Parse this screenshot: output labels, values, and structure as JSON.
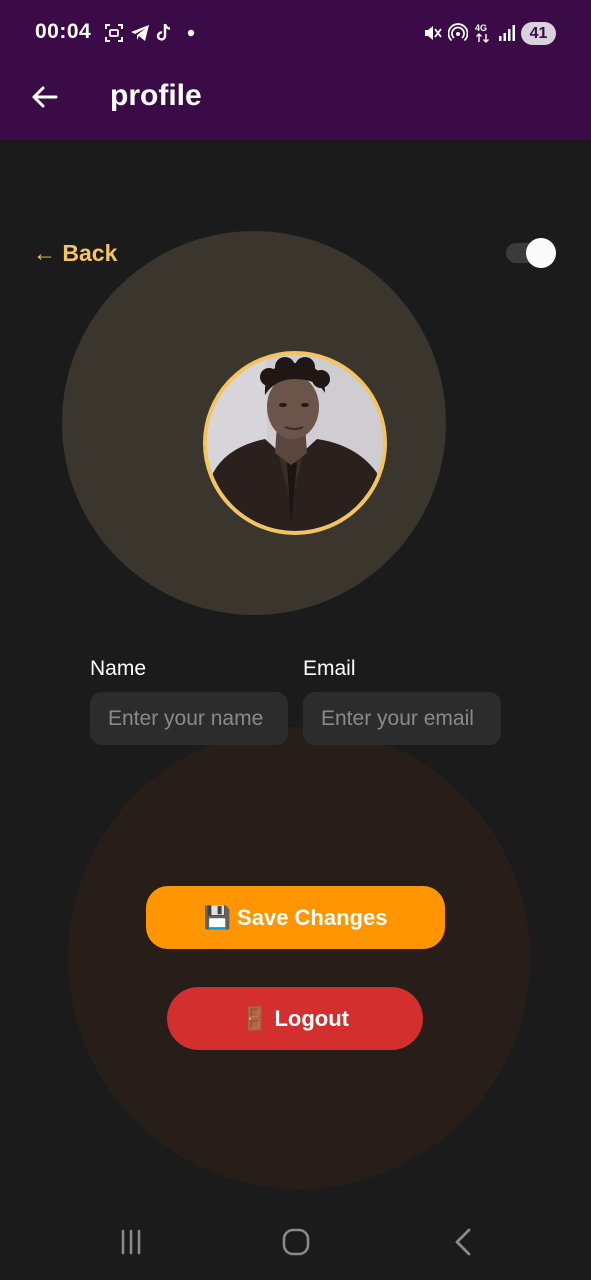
{
  "status_bar": {
    "time": "00:04",
    "battery": "41",
    "left_icons": [
      "screenshot-icon",
      "telegram-icon",
      "tiktok-icon",
      "dot-icon"
    ],
    "right_icons": [
      "mute-icon",
      "hotspot-icon",
      "network-4g-icon",
      "signal-icon"
    ]
  },
  "app_bar": {
    "title": "profile",
    "background": "#3a0b46"
  },
  "profile": {
    "back_label": "← Back",
    "dark_mode_on": true,
    "accent": "#f5c462"
  },
  "form": {
    "name_label": "Name",
    "name_placeholder": "Enter your name",
    "email_label": "Email",
    "email_placeholder": "Enter your email"
  },
  "actions": {
    "save_label": "💾 Save Changes",
    "save_color": "#ff9500",
    "logout_label": "🚪 Logout",
    "logout_color": "#d32f2f"
  },
  "nav_bar": {
    "icons": [
      "recent-apps-icon",
      "home-icon",
      "back-icon"
    ]
  }
}
